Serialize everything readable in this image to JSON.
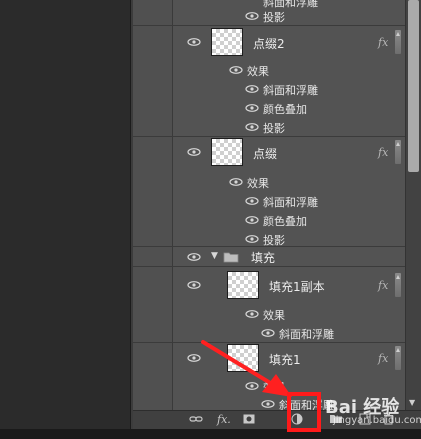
{
  "layers_panel": {
    "top_partial": {
      "label": "投影"
    },
    "layers": [
      {
        "name": "点缀2",
        "fx": "fx",
        "effects_label": "效果",
        "effects": [
          "斜面和浮雕",
          "颜色叠加",
          "投影"
        ]
      },
      {
        "name": "点缀",
        "fx": "fx",
        "effects_label": "效果",
        "effects": [
          "斜面和浮雕",
          "颜色叠加",
          "投影"
        ]
      }
    ],
    "group": {
      "name": "填充"
    },
    "group_layers": [
      {
        "name": "填充1副本",
        "fx": "fx",
        "effects_label": "效果",
        "effects": [
          "斜面和浮雕"
        ]
      },
      {
        "name": "填充1",
        "fx": "fx",
        "effects_label": "效果",
        "effects": [
          "斜面和浮雕"
        ]
      }
    ]
  },
  "bottom_bar": {
    "link_icon": "link-icon",
    "fx_label": "fx.",
    "mask_icon": "mask-icon",
    "adjustment_icon": "adjustment-layer-icon",
    "folder_icon": "folder-icon",
    "new_layer_icon": "new-layer-icon",
    "trash_icon": "trash-icon"
  },
  "annotation": {
    "arrow_color": "#ff2020",
    "box_color": "#ff1a1a"
  },
  "watermark": {
    "main": "Bai 经验",
    "sub": "jingyan.baidu.com"
  }
}
